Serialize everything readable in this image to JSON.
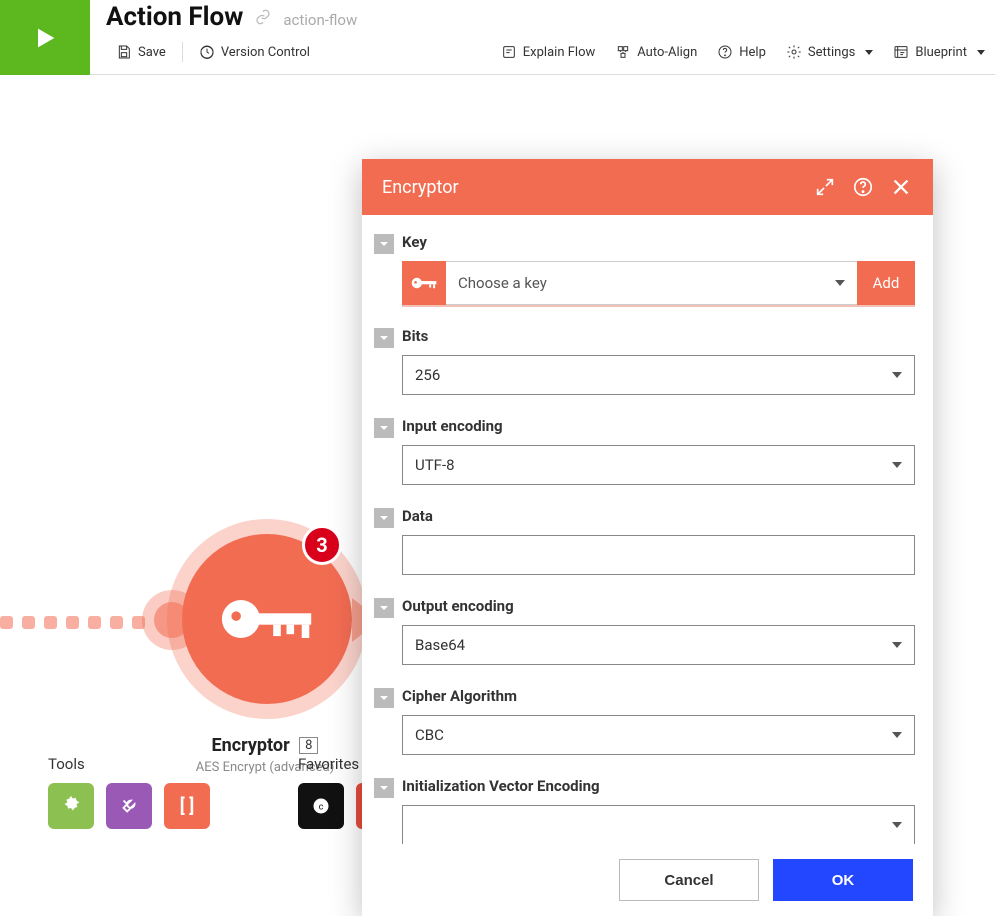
{
  "header": {
    "title": "Action Flow",
    "slug": "action-flow",
    "toolbar": {
      "save": "Save",
      "version": "Version Control",
      "explain": "Explain Flow",
      "align": "Auto-Align",
      "help": "Help",
      "settings": "Settings",
      "blueprint": "Blueprint"
    }
  },
  "node": {
    "badge": "3",
    "name": "Encryptor",
    "step": "8",
    "subtitle": "AES Encrypt (advanced)"
  },
  "bottom": {
    "tools": "Tools",
    "favorites": "Favorites"
  },
  "modal": {
    "title": "Encryptor",
    "fields": {
      "key": {
        "label": "Key",
        "placeholder": "Choose a key",
        "add": "Add"
      },
      "bits": {
        "label": "Bits",
        "value": "256"
      },
      "inputEncoding": {
        "label": "Input encoding",
        "value": "UTF-8"
      },
      "data": {
        "label": "Data",
        "value": ""
      },
      "outputEncoding": {
        "label": "Output encoding",
        "value": "Base64"
      },
      "cipher": {
        "label": "Cipher Algorithm",
        "value": "CBC"
      },
      "ivEncoding": {
        "label": "Initialization Vector Encoding",
        "value": ""
      }
    },
    "buttons": {
      "cancel": "Cancel",
      "ok": "OK"
    }
  }
}
